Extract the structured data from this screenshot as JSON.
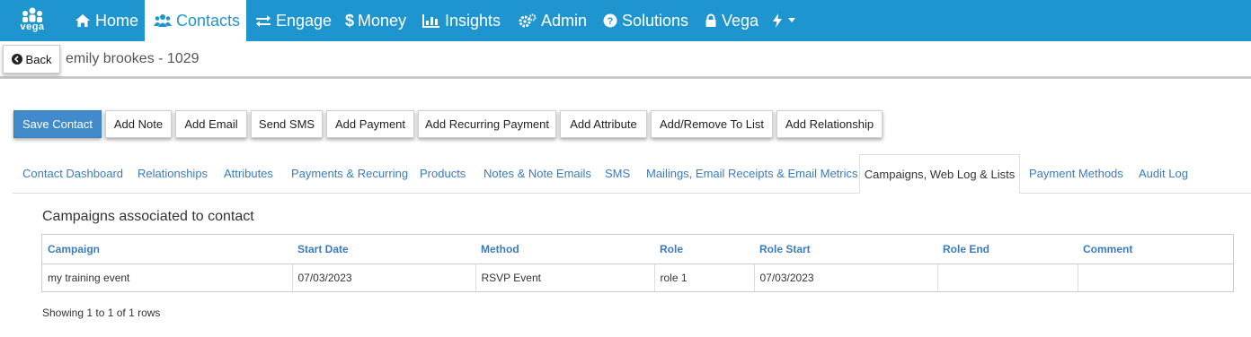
{
  "app": {
    "logo_text": "vega"
  },
  "nav": {
    "home": "Home",
    "contacts": "Contacts",
    "engage": "Engage",
    "money": "Money",
    "insights": "Insights",
    "admin": "Admin",
    "solutions": "Solutions",
    "vega": "Vega"
  },
  "header": {
    "back_label": "Back",
    "contact_name": "emily brookes - 1029"
  },
  "actions": {
    "save": "Save Contact",
    "add_note": "Add Note",
    "add_email": "Add Email",
    "send_sms": "Send SMS",
    "add_payment": "Add Payment",
    "add_recurring": "Add Recurring Payment",
    "add_attribute": "Add Attribute",
    "add_remove_list": "Add/Remove To List",
    "add_relationship": "Add Relationship"
  },
  "tabs": {
    "dashboard": "Contact Dashboard",
    "relationships": "Relationships",
    "attributes": "Attributes",
    "payments": "Payments & Recurring",
    "products": "Products",
    "notes": "Notes & Note Emails",
    "sms": "SMS",
    "mailings": "Mailings, Email Receipts & Email Metrics",
    "campaigns": "Campaigns, Web Log & Lists",
    "payment_methods": "Payment Methods",
    "audit_log": "Audit Log"
  },
  "campaigns": {
    "title": "Campaigns associated to contact",
    "columns": {
      "campaign": "Campaign",
      "start_date": "Start Date",
      "method": "Method",
      "role": "Role",
      "role_start": "Role Start",
      "role_end": "Role End",
      "comment": "Comment"
    },
    "rows": [
      {
        "campaign": "my training event",
        "start_date": "07/03/2023",
        "method": "RSVP Event",
        "role": "role 1",
        "role_start": "07/03/2023",
        "role_end": "",
        "comment": ""
      }
    ],
    "showing": "Showing 1 to 1 of 1 rows"
  },
  "colors": {
    "nav_bg": "#1f95cf",
    "primary_button": "#428bca",
    "link": "#3a7bbf"
  }
}
